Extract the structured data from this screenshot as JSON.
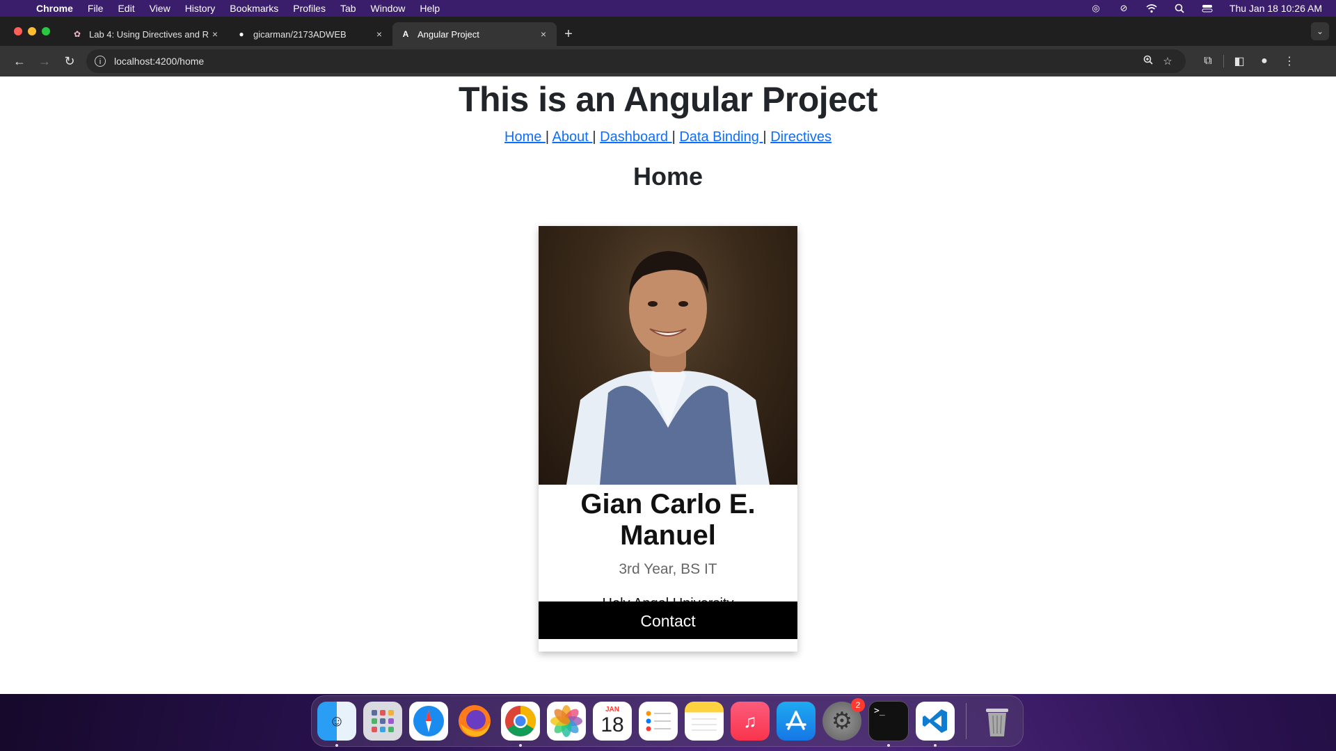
{
  "menubar": {
    "app_name": "Chrome",
    "items": [
      "File",
      "Edit",
      "View",
      "History",
      "Bookmarks",
      "Profiles",
      "Tab",
      "Window",
      "Help"
    ],
    "clock": "Thu Jan 18  10:26 AM"
  },
  "tabs": [
    {
      "title": "Lab 4: Using Directives and R",
      "close": "×"
    },
    {
      "title": "gicarman/2173ADWEB",
      "close": "×"
    },
    {
      "title": "Angular Project",
      "close": "×"
    }
  ],
  "toolbar": {
    "url": "localhost:4200/home",
    "new_tab": "+"
  },
  "page": {
    "heading": "This is an Angular Project",
    "nav": [
      "Home ",
      "About ",
      "Dashboard ",
      "Data Binding ",
      "Directives"
    ],
    "section_title": "Home",
    "card": {
      "name": "Gian Carlo E. Manuel",
      "title": "3rd Year, BS IT",
      "school": "Holy Angel University",
      "button": "Contact"
    }
  },
  "dock": {
    "calendar_month": "JAN",
    "calendar_day": "18",
    "settings_badge": "2",
    "terminal_prompt": ">_"
  }
}
